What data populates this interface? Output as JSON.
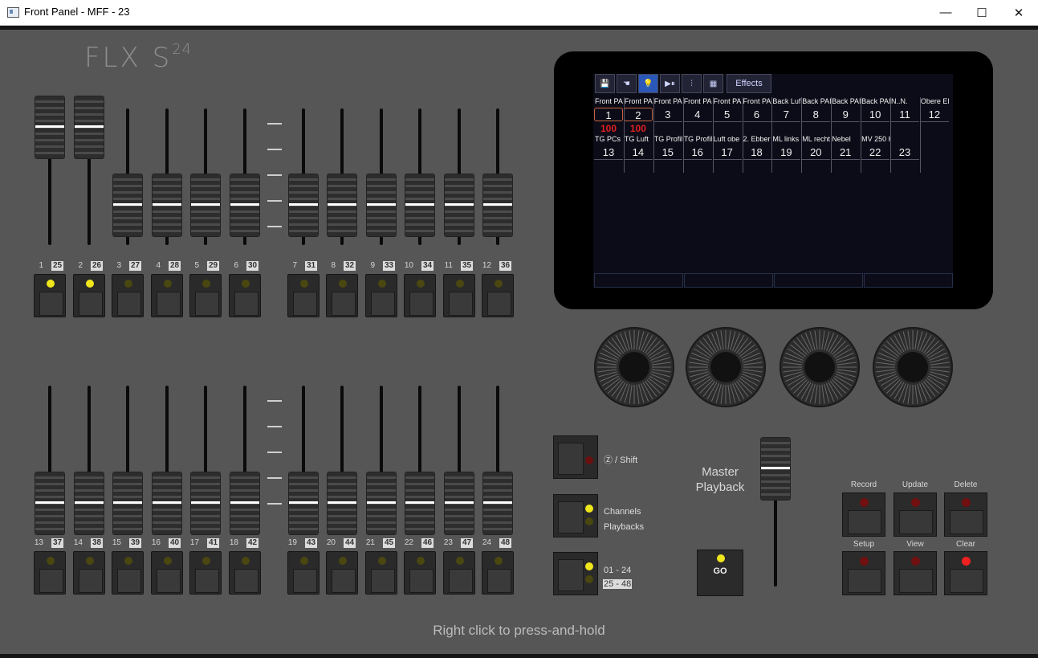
{
  "window": {
    "title": "Front Panel - MFF - 23",
    "minimize": "—",
    "maximize": "☐",
    "close": "✕"
  },
  "logo": {
    "main": "FLX S",
    "sup": "24"
  },
  "colors": {
    "panel": "#565656",
    "led_on": "#f0e61c",
    "led_red": "#f02020",
    "lcd_accent": "#2b57b8"
  },
  "faders_top": [
    {
      "num": "1",
      "page": "25",
      "level": 0.95,
      "led": true
    },
    {
      "num": "2",
      "page": "26",
      "level": 0.95,
      "led": true
    },
    {
      "num": "3",
      "page": "27",
      "level": 0.2,
      "led": false
    },
    {
      "num": "4",
      "page": "28",
      "level": 0.2,
      "led": false
    },
    {
      "num": "5",
      "page": "29",
      "level": 0.2,
      "led": false
    },
    {
      "num": "6",
      "page": "30",
      "level": 0.2,
      "led": false
    },
    {
      "num": "7",
      "page": "31",
      "level": 0.2,
      "led": false
    },
    {
      "num": "8",
      "page": "32",
      "level": 0.2,
      "led": false
    },
    {
      "num": "9",
      "page": "33",
      "level": 0.2,
      "led": false
    },
    {
      "num": "10",
      "page": "34",
      "level": 0.2,
      "led": false
    },
    {
      "num": "11",
      "page": "35",
      "level": 0.2,
      "led": false
    },
    {
      "num": "12",
      "page": "36",
      "level": 0.2,
      "led": false
    }
  ],
  "faders_bottom": [
    {
      "num": "13",
      "page": "37",
      "level": 0.0,
      "led": false
    },
    {
      "num": "14",
      "page": "38",
      "level": 0.0,
      "led": false
    },
    {
      "num": "15",
      "page": "39",
      "level": 0.0,
      "led": false
    },
    {
      "num": "16",
      "page": "40",
      "level": 0.0,
      "led": false
    },
    {
      "num": "17",
      "page": "41",
      "level": 0.0,
      "led": false
    },
    {
      "num": "18",
      "page": "42",
      "level": 0.0,
      "led": false
    },
    {
      "num": "19",
      "page": "43",
      "level": 0.0,
      "led": false
    },
    {
      "num": "20",
      "page": "44",
      "level": 0.0,
      "led": false
    },
    {
      "num": "21",
      "page": "45",
      "level": 0.0,
      "led": false
    },
    {
      "num": "22",
      "page": "46",
      "level": 0.0,
      "led": false
    },
    {
      "num": "23",
      "page": "47",
      "level": 0.0,
      "led": false
    },
    {
      "num": "24",
      "page": "48",
      "level": 0.0,
      "led": false
    }
  ],
  "toolbar": [
    {
      "icon": "save-icon",
      "glyph": "💾"
    },
    {
      "icon": "palette-hand-icon",
      "glyph": "☚"
    },
    {
      "icon": "bulb-icon",
      "glyph": "💡",
      "active": true
    },
    {
      "icon": "play-pause-icon",
      "glyph": "▶⏸"
    },
    {
      "icon": "sliders-icon",
      "glyph": "⫶"
    },
    {
      "icon": "grid-icon",
      "glyph": "▦"
    }
  ],
  "effects_tab": "Effects",
  "channels_row1": [
    {
      "name": "Front PA",
      "no": "1",
      "val": "100",
      "sel": true
    },
    {
      "name": "Front PA",
      "no": "2",
      "val": "100",
      "sel": true
    },
    {
      "name": "Front PA",
      "no": "3"
    },
    {
      "name": "Front PA",
      "no": "4"
    },
    {
      "name": "Front PA",
      "no": "5"
    },
    {
      "name": "Front PA",
      "no": "6"
    },
    {
      "name": "Back Luf",
      "no": "7"
    },
    {
      "name": "Back PAI",
      "no": "8"
    },
    {
      "name": "Back PAI",
      "no": "9"
    },
    {
      "name": "Back PAI",
      "no": "10"
    },
    {
      "name": "N..N.",
      "no": "11"
    },
    {
      "name": "Obere El",
      "no": "12"
    }
  ],
  "channels_row2": [
    {
      "name": "TG PCs",
      "no": "13"
    },
    {
      "name": "TG Luft",
      "no": "14"
    },
    {
      "name": "TG Profil",
      "no": "15"
    },
    {
      "name": "TG Profil",
      "no": "16"
    },
    {
      "name": "Luft obe",
      "no": "17"
    },
    {
      "name": "2. Ebber",
      "no": "18"
    },
    {
      "name": "ML links",
      "no": "19"
    },
    {
      "name": "ML recht",
      "no": "20"
    },
    {
      "name": "Nebel",
      "no": "21"
    },
    {
      "name": "MV 250 H",
      "no": "22"
    },
    {
      "name": "",
      "no": "23"
    }
  ],
  "side": {
    "shift": "Ⓩ / Shift",
    "channels": "Channels",
    "playbacks": "Playbacks",
    "page1": "01 - 24",
    "page2": "25 - 48"
  },
  "master": {
    "line1": "Master",
    "line2": "Playback",
    "go": "GO",
    "level": 0.92
  },
  "right_buttons": [
    {
      "label": "Record",
      "bright": false
    },
    {
      "label": "Update",
      "bright": false
    },
    {
      "label": "Delete",
      "bright": false
    },
    {
      "label": "Setup",
      "bright": false
    },
    {
      "label": "View",
      "bright": false
    },
    {
      "label": "Clear",
      "bright": true
    }
  ],
  "hint": "Right click to press-and-hold"
}
